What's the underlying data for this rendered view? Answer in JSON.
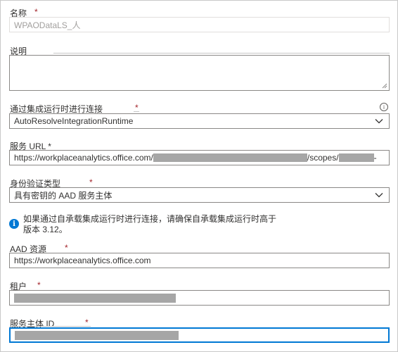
{
  "fields": {
    "name": {
      "label": "名称",
      "required_mark": "*",
      "placeholder": "WPAODataLS_人"
    },
    "description": {
      "label": "说明"
    },
    "integration_runtime": {
      "label": "通过集成运行时进行连接",
      "required_mark": "*",
      "value": "AutoResolveIntegrationRuntime"
    },
    "service_url": {
      "label": "服务 URL *",
      "value_prefix": "https://workplaceanalytics.office.com/",
      "value_mid": "/scopes/",
      "value_suffix": "-"
    },
    "auth_type": {
      "label": "身份验证类型",
      "required_mark": "*",
      "value": "具有密钥的 AAD 服务主体"
    },
    "info": {
      "line1": "如果通过自承载集成运行时进行连接，请确保自承载集成运行时高于",
      "line2": "版本 3.12。"
    },
    "aad_resource": {
      "label": "AAD 资源",
      "required_mark": "*",
      "value": "https://workplaceanalytics.office.com"
    },
    "tenant": {
      "label": "租户",
      "required_mark": "*"
    },
    "service_principal_id": {
      "label": "服务主体 ID",
      "required_mark": "*"
    }
  },
  "icons": {
    "info": "info-icon",
    "tooltip": "info-tooltip-icon",
    "dropdown": "chevron-down-icon",
    "resize": "resize-grip-icon"
  },
  "colors": {
    "required": "#a4262c",
    "focus_border": "#0078d4",
    "info_icon": "#0078d4",
    "redaction": "#a6a6a6"
  }
}
